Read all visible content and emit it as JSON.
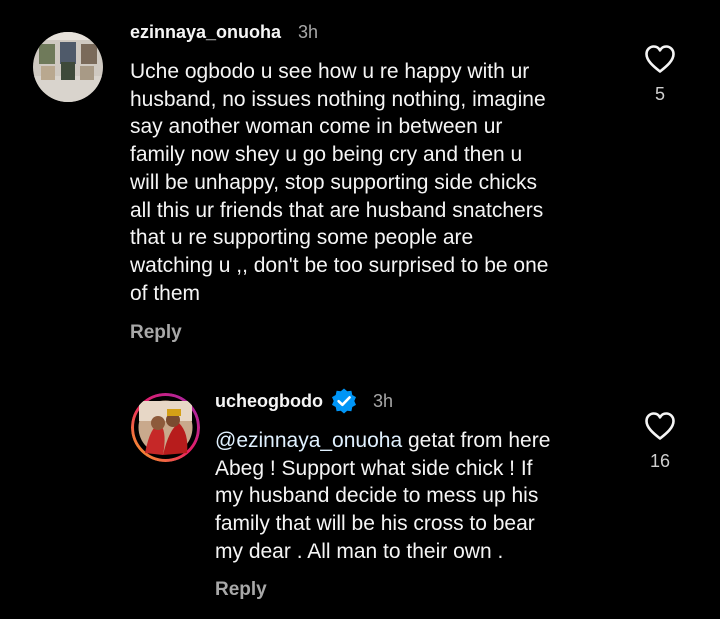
{
  "comments": [
    {
      "username": "ezinnaya_onuoha",
      "time": "3h",
      "lines": [
        "Uche ogbodo u see how u re happy with ur",
        "husband, no issues nothing nothing, imagine",
        "say another woman come in between ur",
        "family now shey u go being cry and then u",
        "will be unhappy, stop supporting side chicks",
        "all this ur friends that are husband snatchers",
        "that u re supporting some people are",
        "watching u ,, don't be too surprised to be one",
        "of them"
      ],
      "reply_label": "Reply",
      "like_count": "5",
      "liked": false
    },
    {
      "username": "ucheogbodo",
      "verified": true,
      "time": "3h",
      "mention": "@ezinnaya_onuoha",
      "first_line_rest": " getat from here",
      "lines": [
        "Abeg ! Support what side chick ! If",
        "my husband decide to mess up his",
        "family that will be his cross to bear",
        "my dear . All man to their own ."
      ],
      "reply_label": "Reply",
      "like_count": "16",
      "liked": false
    }
  ],
  "colors": {
    "background": "#000000",
    "text": "#f5f5f5",
    "secondary": "#a8a8a8",
    "verified_badge": "#0095f6"
  },
  "icons": {
    "like": "heart-outline-icon",
    "verified": "verified-badge-icon"
  }
}
